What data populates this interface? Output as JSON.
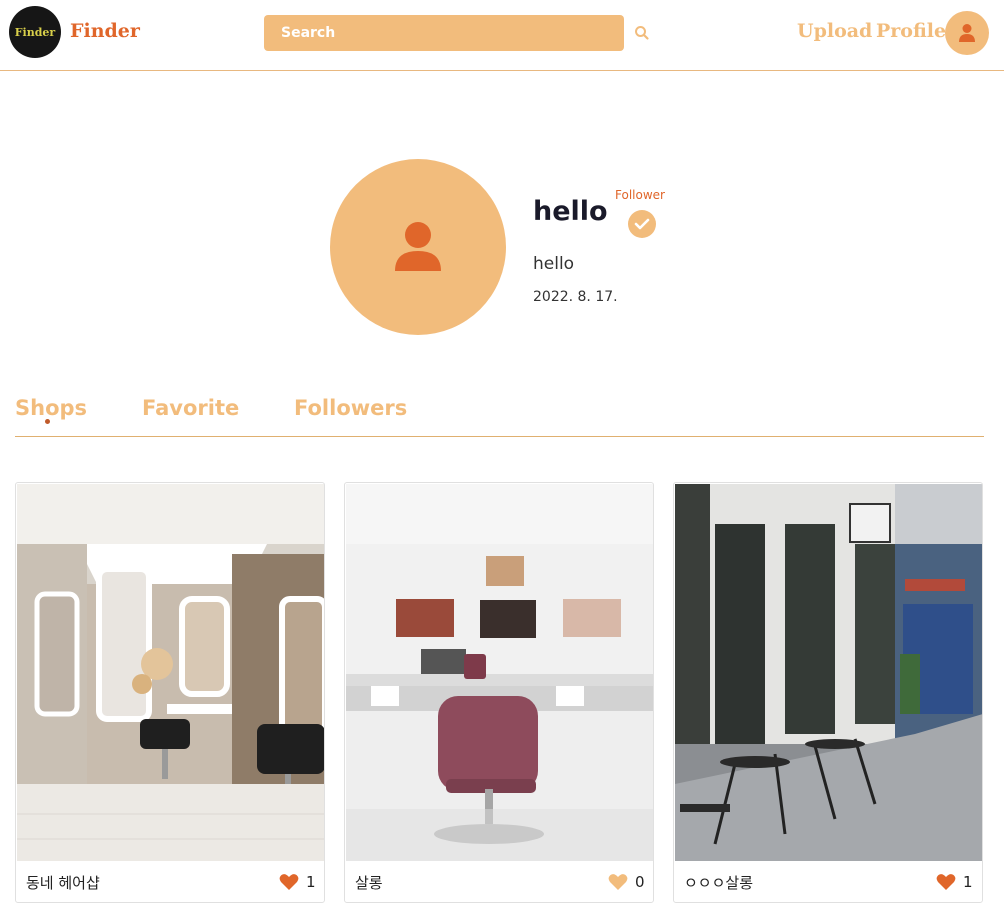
{
  "header": {
    "logo_text": "Finder",
    "brand": "Finder",
    "search_placeholder": "Search",
    "nav": {
      "upload": "Upload",
      "profile": "Profile"
    }
  },
  "profile": {
    "username": "hello",
    "follower_label": "Follower",
    "bio": "hello",
    "joined": "2022. 8. 17."
  },
  "tabs": [
    {
      "label": "Shops",
      "active": true
    },
    {
      "label": "Favorite",
      "active": false
    },
    {
      "label": "Followers",
      "active": false
    }
  ],
  "shops": [
    {
      "name": "동네 헤어샵",
      "likes": "1",
      "liked": true
    },
    {
      "name": "살롱",
      "likes": "0",
      "liked": false
    },
    {
      "name": "ㅇㅇㅇ살롱",
      "likes": "1",
      "liked": true
    }
  ],
  "colors": {
    "accent": "#e0662a",
    "accent_light": "#f2bc7c",
    "heart_liked": "#e0662a",
    "heart_unliked": "#f2bc7c"
  },
  "icons": {
    "search": "search-icon",
    "user": "user-icon",
    "check": "check-icon",
    "heart": "heart-icon"
  }
}
